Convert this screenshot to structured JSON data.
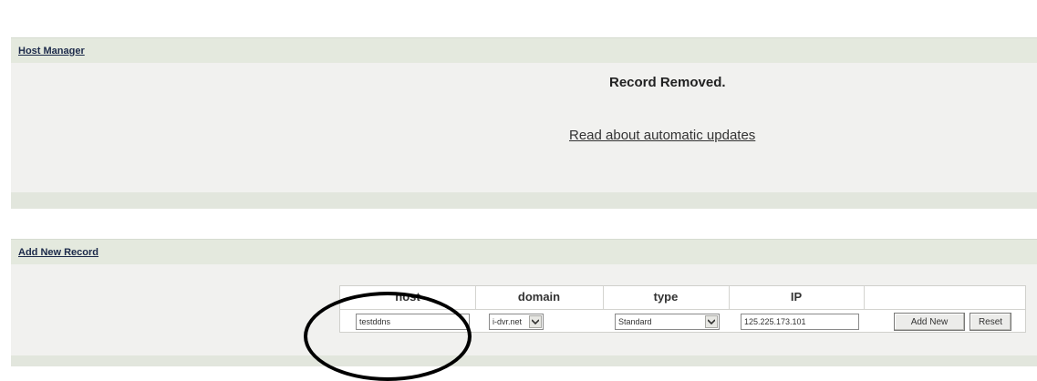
{
  "host_manager": {
    "title": "Host Manager",
    "status_message": "Record Removed.",
    "updates_link": "Read about automatic updates"
  },
  "add_record": {
    "title": "Add New Record",
    "columns": [
      "host",
      "domain",
      "type",
      "IP"
    ],
    "host_value": "testddns",
    "domain_value": "i-dvr.net",
    "type_value": "Standard",
    "ip_value": "125.225.173.101",
    "add_button": "Add New",
    "reset_button": "Reset"
  },
  "icons": {
    "dropdown": "chevron-down-icon"
  },
  "colors": {
    "panel_header": "#e4e9de",
    "panel_body": "#f1f1ef",
    "annotation": "#000000"
  }
}
